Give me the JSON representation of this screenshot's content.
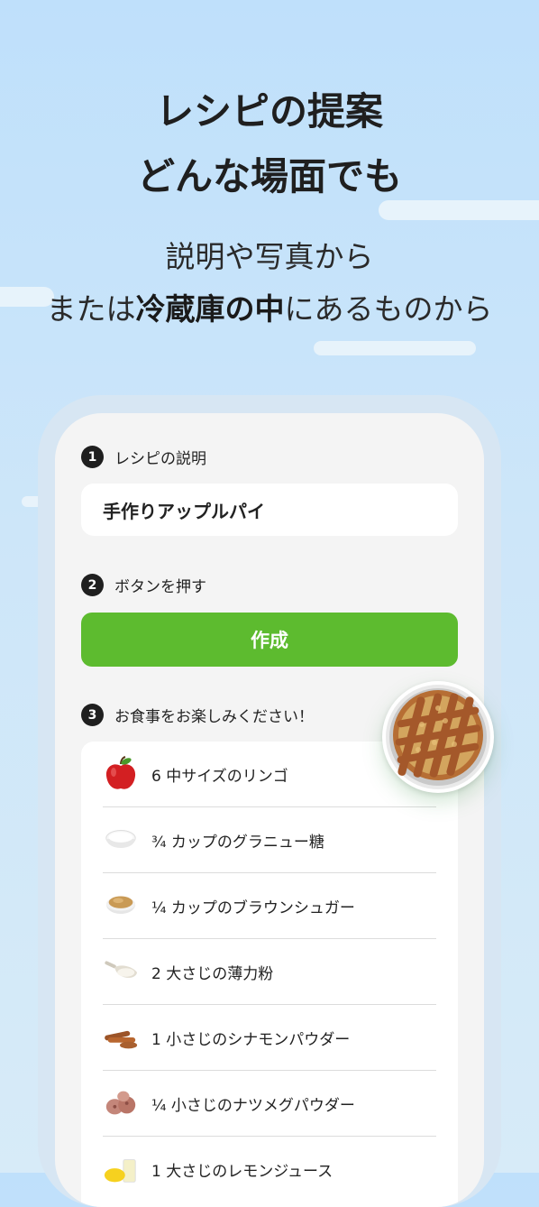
{
  "hero": {
    "title_line1": "レシピの提案",
    "title_line2": "どんな場面でも",
    "subtitle_line1": "説明や写真から",
    "subtitle_line2_pre": "または",
    "subtitle_line2_bold": "冷蔵庫の中",
    "subtitle_line2_post": "にあるものから"
  },
  "steps": [
    {
      "number": "1",
      "label": "レシピの説明"
    },
    {
      "number": "2",
      "label": "ボタンを押す"
    },
    {
      "number": "3",
      "label": "お食事をお楽しみください！"
    }
  ],
  "description_input": {
    "value": "手作りアップルパイ"
  },
  "create_button": {
    "label": "作成"
  },
  "ingredients": [
    {
      "text": "6 中サイズのリンゴ",
      "icon": "apple-icon"
    },
    {
      "text": "¾ カップのグラニュー糖",
      "icon": "sugar-bowl-icon"
    },
    {
      "text": "¼ カップのブラウンシュガー",
      "icon": "brown-sugar-icon"
    },
    {
      "text": "2 大さじの薄力粉",
      "icon": "flour-scoop-icon"
    },
    {
      "text": "1 小さじのシナモンパウダー",
      "icon": "cinnamon-icon"
    },
    {
      "text": "¼ 小さじのナツメグパウダー",
      "icon": "nutmeg-icon"
    },
    {
      "text": "1 大さじのレモンジュース",
      "icon": "lemon-juice-icon"
    }
  ],
  "colors": {
    "accent_green": "#5dbb2f",
    "background_sky": "#c6e3fa"
  }
}
